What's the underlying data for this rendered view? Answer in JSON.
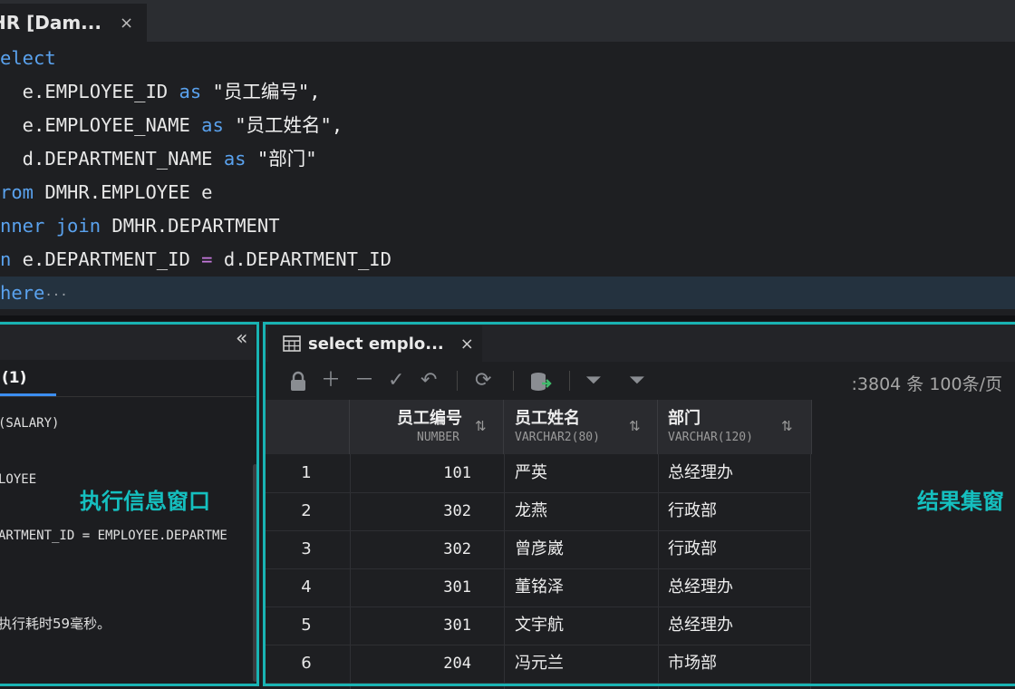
{
  "editor_tab": {
    "title": "HR [Dam...",
    "close": "×"
  },
  "code": {
    "l1": {
      "kw": "elect"
    },
    "l2": {
      "a": "  e.EMPLOYEE_ID ",
      "kw": "as",
      "s": " \"员工编号\","
    },
    "l3": {
      "a": "  e.EMPLOYEE_NAME ",
      "kw": "as",
      "s": " \"员工姓名\","
    },
    "l4": {
      "a": "  d.DEPARTMENT_NAME ",
      "kw": "as",
      "s": " \"部门\""
    },
    "l5": {
      "kw": "rom",
      "a": " DMHR.EMPLOYEE e"
    },
    "l6": {
      "kw": "nner join",
      "a": " DMHR.DEPARTMENT"
    },
    "l7": {
      "kw": "n",
      "a": " e.DEPARTMENT_ID ",
      "op": "=",
      "b": " d.DEPARTMENT_ID"
    },
    "l8": {
      "kw": "here",
      "fold": "···"
    }
  },
  "info_panel": {
    "collapse": "«",
    "tab": "(1)",
    "lines": [
      "(SALARY)",
      "LOYEE",
      "ARTMENT_ID = EMPLOYEE.DEPARTME"
    ],
    "note": "执行耗时59毫秒。",
    "overlay_label": "执行信息窗口"
  },
  "result_panel": {
    "tab_label": "select emplo...",
    "tab_close": "×",
    "toolbar_icons": [
      "lock-icon",
      "add-icon",
      "remove-icon",
      "check-icon",
      "undo-icon",
      "refresh-icon",
      "export-icon",
      "filter-icon",
      "filter-column-icon"
    ],
    "total": ":3804 条  100条/页 ",
    "overlay_label": "结果集窗",
    "columns": [
      {
        "name": "员工编号",
        "type": "NUMBER"
      },
      {
        "name": "员工姓名",
        "type": "VARCHAR2(80)"
      },
      {
        "name": "部门",
        "type": "VARCHAR(120)"
      }
    ],
    "sort_glyph": "⇅",
    "rows": [
      {
        "n": "1",
        "id": "101",
        "name": "严英",
        "dept": "总经理办"
      },
      {
        "n": "2",
        "id": "302",
        "name": "龙燕",
        "dept": "行政部"
      },
      {
        "n": "3",
        "id": "302",
        "name": "曾彦崴",
        "dept": "行政部"
      },
      {
        "n": "4",
        "id": "301",
        "name": "董铭泽",
        "dept": "总经理办"
      },
      {
        "n": "5",
        "id": "301",
        "name": "文宇航",
        "dept": "总经理办"
      },
      {
        "n": "6",
        "id": "204",
        "name": "冯元兰",
        "dept": "市场部"
      }
    ]
  },
  "colors": {
    "accent": "#19b3b3",
    "keyword": "#5aa2ee",
    "operator": "#c678dd"
  }
}
